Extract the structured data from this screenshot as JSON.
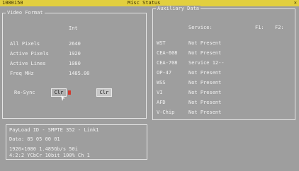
{
  "titlebar": {
    "left": "1080i50",
    "center": "Misc Status",
    "right_icon": "close-icon"
  },
  "video_format": {
    "title": "Video Format",
    "format_value": "Int",
    "rows": [
      {
        "label": "All Pixels",
        "value": "2640"
      },
      {
        "label": "Active Pixels",
        "value": "1920"
      },
      {
        "label": "Active Lines",
        "value": "1080"
      },
      {
        "label": "Freq MHz",
        "value": "1485.00"
      }
    ],
    "resync_label": "Re-Sync",
    "clr1": "Clr",
    "clr2": "Clr"
  },
  "auxiliary": {
    "title": "Auxiliary Data",
    "service_header": "Service:",
    "f1_header": "F1:",
    "f2_header": "F2:",
    "rows": [
      {
        "label": "WST",
        "status": "Not Present"
      },
      {
        "label": "CEA-608",
        "status": "Not Present"
      },
      {
        "label": "CEA-708",
        "status": "Service 12--"
      },
      {
        "label": "OP-47",
        "status": "Not Present"
      },
      {
        "label": "WSS",
        "status": "Not Present"
      },
      {
        "label": "VI",
        "status": "Not Present"
      },
      {
        "label": "AFD",
        "status": "Not Present"
      },
      {
        "label": "V-Chip",
        "status": "Not Present"
      }
    ]
  },
  "payload": {
    "title": "PayLoad ID - SMPTE 352 - Link1",
    "data": "Data: 85 05 00 01",
    "line1": "1920×1080 1.485Gb/s 50i",
    "line2": "4:2:2 YCbCr  10bit 100% Ch 1"
  },
  "colors": {
    "background": "#9e9e9e",
    "titlebar": "#e2cf3f",
    "text": "#f2f2f2",
    "indicator": "#d13b2f"
  }
}
